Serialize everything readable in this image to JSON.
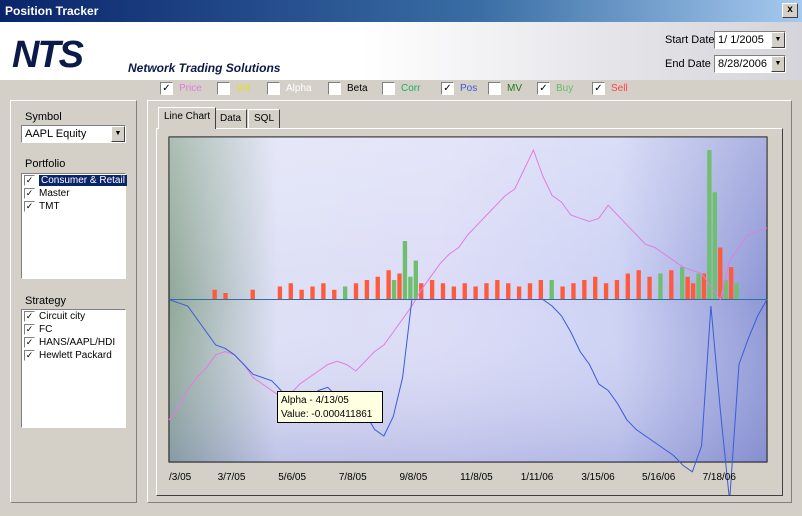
{
  "window": {
    "title": "Position Tracker",
    "close_glyph": "x"
  },
  "header": {
    "logo_text": "NTS",
    "logo_subtitle": "Network Trading Solutions",
    "start_date_label": "Start Date",
    "start_date_value": "1/ 1/2005",
    "end_date_label": "End Date",
    "end_date_value": "8/28/2006"
  },
  "series_toggles": [
    {
      "label": "Price",
      "checked": true,
      "color": "#e37be3"
    },
    {
      "label": "Vol",
      "checked": false,
      "color": "#e0e020"
    },
    {
      "label": "Alpha",
      "checked": false,
      "color": "#ffffff"
    },
    {
      "label": "Beta",
      "checked": false,
      "color": "#000000"
    },
    {
      "label": "Corr",
      "checked": false,
      "color": "#22aa66"
    },
    {
      "label": "Pos",
      "checked": true,
      "color": "#3a5bd9"
    },
    {
      "label": "MV",
      "checked": false,
      "color": "#1a7a1a"
    },
    {
      "label": "Buy",
      "checked": true,
      "color": "#66bb66"
    },
    {
      "label": "Sell",
      "checked": true,
      "color": "#ff4444"
    }
  ],
  "symbol": {
    "label": "Symbol",
    "value": "AAPL Equity"
  },
  "portfolio": {
    "label": "Portfolio",
    "items": [
      {
        "label": "Consumer & Retail",
        "checked": true,
        "selected": true
      },
      {
        "label": "Master",
        "checked": true,
        "selected": false
      },
      {
        "label": "TMT",
        "checked": true,
        "selected": false
      }
    ]
  },
  "strategy": {
    "label": "Strategy",
    "items": [
      {
        "label": "Circuit city",
        "checked": true
      },
      {
        "label": "FC",
        "checked": true
      },
      {
        "label": "HANS/AAPL/HDI",
        "checked": true
      },
      {
        "label": "Hewlett Packard",
        "checked": true
      }
    ]
  },
  "tabs": [
    {
      "label": "Line Chart",
      "active": true
    },
    {
      "label": "Data",
      "active": false
    },
    {
      "label": "SQL",
      "active": false
    }
  ],
  "tooltip": {
    "line1": "Alpha - 4/13/05",
    "line2": "Value: -0.000411861"
  },
  "chart_data": {
    "type": "line",
    "x_tick_labels": [
      "/3/05",
      "3/7/05",
      "5/6/05",
      "7/8/05",
      "9/8/05",
      "11/8/05",
      "1/11/06",
      "3/15/06",
      "5/16/06",
      "7/18/06"
    ],
    "series": [
      {
        "name": "Price",
        "color": "#e37be3",
        "values": [
          0.13,
          0.17,
          0.22,
          0.26,
          0.29,
          0.33,
          0.34,
          0.33,
          0.3,
          0.26,
          0.24,
          0.22,
          0.2,
          0.21,
          0.24,
          0.26,
          0.28,
          0.3,
          0.31,
          0.3,
          0.28,
          0.31,
          0.34,
          0.36,
          0.4,
          0.44,
          0.48,
          0.53,
          0.57,
          0.61,
          0.64,
          0.66,
          0.7,
          0.73,
          0.76,
          0.79,
          0.82,
          0.84,
          0.9,
          0.96,
          0.88,
          0.82,
          0.8,
          0.76,
          0.75,
          0.74,
          0.75,
          0.79,
          0.76,
          0.73,
          0.7,
          0.67,
          0.66,
          0.64,
          0.62,
          0.6,
          0.59,
          0.58,
          0.54,
          0.5,
          0.62,
          0.66,
          0.7,
          0.71,
          0.72
        ]
      },
      {
        "name": "Pos",
        "color": "#3a5bd9",
        "values": [
          0.5,
          0.49,
          0.48,
          0.44,
          0.4,
          0.36,
          0.35,
          0.33,
          0.3,
          0.27,
          0.26,
          0.25,
          0.22,
          0.18,
          0.16,
          0.2,
          0.22,
          0.23,
          0.2,
          0.19,
          0.19,
          0.15,
          0.1,
          0.08,
          0.14,
          0.26,
          0.5,
          0.5,
          0.5,
          0.5,
          0.5,
          0.5,
          0.5,
          0.5,
          0.5,
          0.5,
          0.5,
          0.5,
          0.5,
          0.5,
          0.5,
          0.48,
          0.45,
          0.4,
          0.34,
          0.3,
          0.24,
          0.22,
          0.18,
          0.13,
          0.1,
          0.08,
          0.06,
          0.04,
          0.02,
          -0.01,
          -0.03,
          0.05,
          0.48,
          0.16,
          -0.12,
          0.3,
          0.38,
          0.45,
          0.5
        ]
      }
    ],
    "baseline": 0.5,
    "buy_bars": [
      [
        32,
        0.04
      ],
      [
        41,
        0.06
      ],
      [
        43,
        0.18
      ],
      [
        44,
        0.07
      ],
      [
        45,
        0.12
      ],
      [
        70,
        0.06
      ],
      [
        90,
        0.08
      ],
      [
        94,
        0.1
      ],
      [
        97,
        0.08
      ],
      [
        99,
        0.46
      ],
      [
        100,
        0.33
      ],
      [
        102,
        0.06
      ],
      [
        104,
        0.05
      ]
    ],
    "sell_bars": [
      [
        8,
        0.03
      ],
      [
        10,
        0.02
      ],
      [
        15,
        0.03
      ],
      [
        20,
        0.04
      ],
      [
        22,
        0.05
      ],
      [
        24,
        0.03
      ],
      [
        26,
        0.04
      ],
      [
        28,
        0.05
      ],
      [
        30,
        0.03
      ],
      [
        34,
        0.05
      ],
      [
        36,
        0.06
      ],
      [
        38,
        0.07
      ],
      [
        40,
        0.09
      ],
      [
        42,
        0.08
      ],
      [
        46,
        0.05
      ],
      [
        48,
        0.06
      ],
      [
        50,
        0.05
      ],
      [
        52,
        0.04
      ],
      [
        54,
        0.05
      ],
      [
        56,
        0.04
      ],
      [
        58,
        0.05
      ],
      [
        60,
        0.06
      ],
      [
        62,
        0.05
      ],
      [
        64,
        0.04
      ],
      [
        66,
        0.05
      ],
      [
        68,
        0.06
      ],
      [
        72,
        0.04
      ],
      [
        74,
        0.05
      ],
      [
        76,
        0.06
      ],
      [
        78,
        0.07
      ],
      [
        80,
        0.05
      ],
      [
        82,
        0.06
      ],
      [
        84,
        0.08
      ],
      [
        86,
        0.09
      ],
      [
        88,
        0.07
      ],
      [
        92,
        0.09
      ],
      [
        95,
        0.07
      ],
      [
        96,
        0.05
      ],
      [
        98,
        0.08
      ],
      [
        101,
        0.16
      ],
      [
        103,
        0.1
      ]
    ]
  }
}
